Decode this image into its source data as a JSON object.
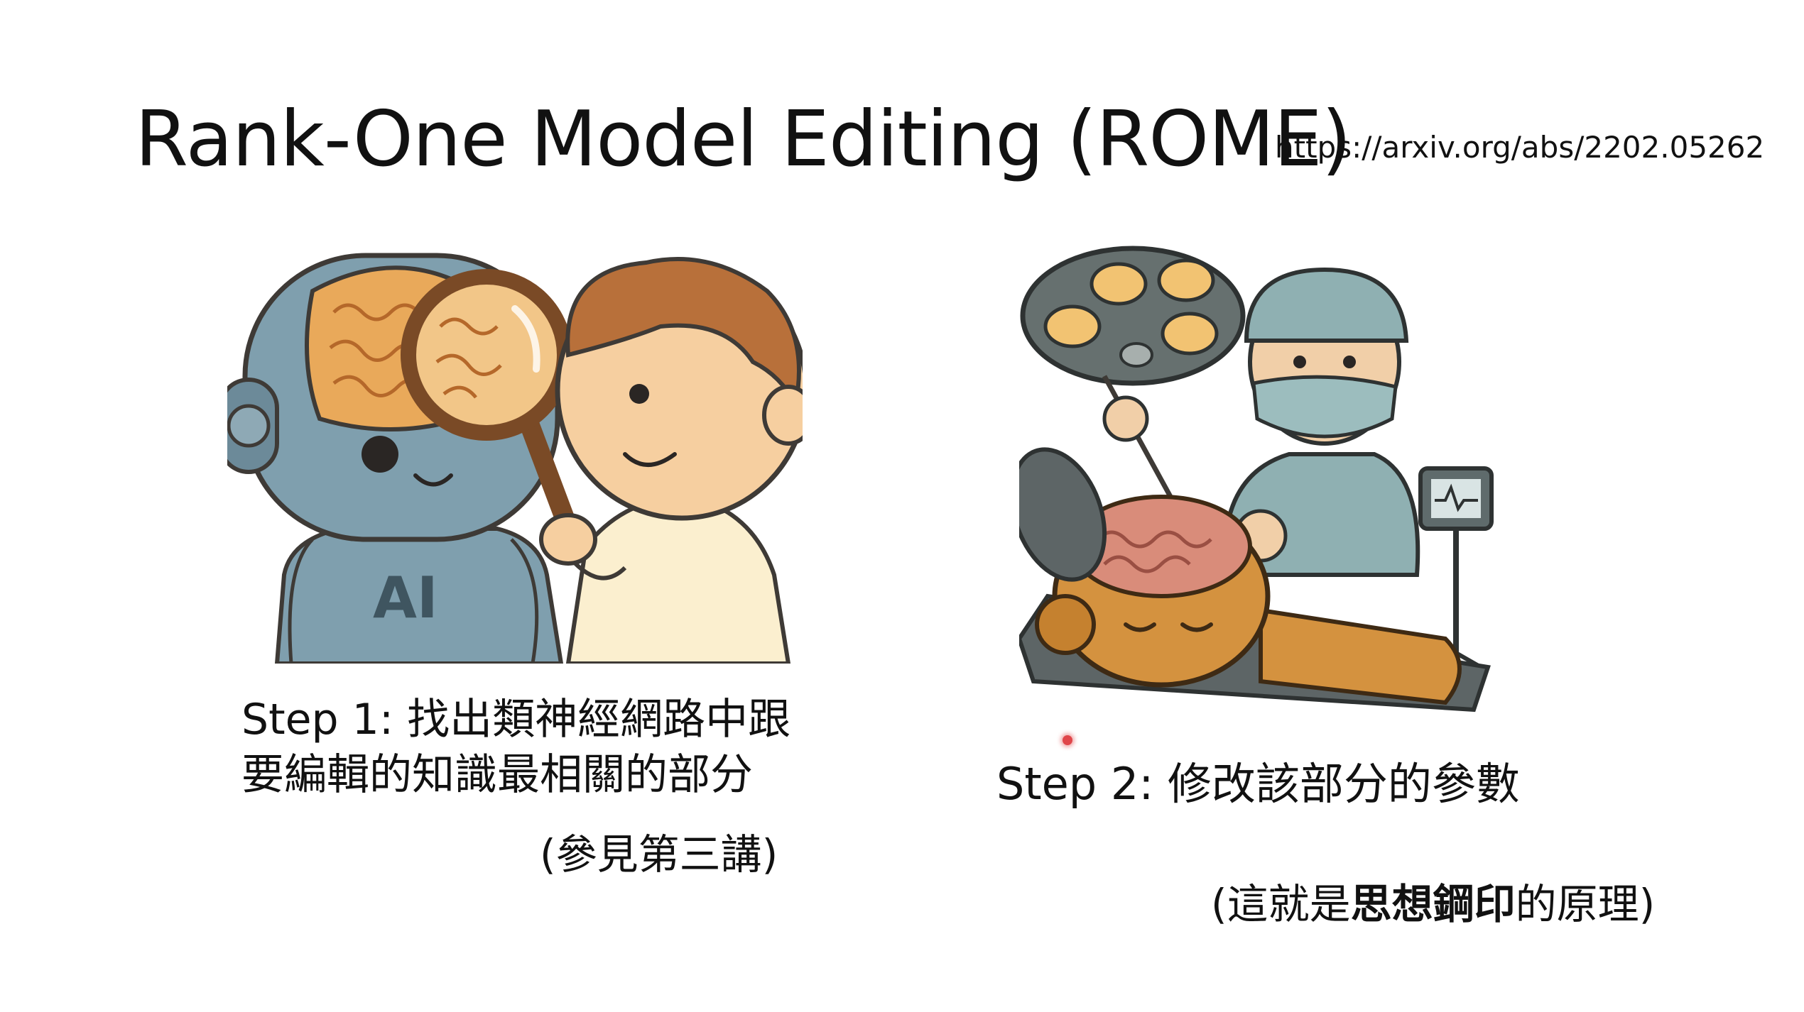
{
  "slide": {
    "title": "Rank-One Model Editing (ROME)",
    "url": "https://arxiv.org/abs/2202.05262",
    "step1": {
      "line1": "Step 1: 找出類神經網路中跟",
      "line2": "要編輯的知識最相關的部分",
      "ref": "(參見第三講)"
    },
    "step2": {
      "text": "Step 2: 修改該部分的參數"
    },
    "principle": {
      "prefix": "(這就是",
      "bold": "思想鋼印",
      "suffix": "的原理)"
    },
    "illustration1": {
      "robot_label": "AI"
    }
  },
  "colors": {
    "robot_blue": "#7f9fae",
    "brain_orange": "#e9a95a",
    "skin": "#f6cfa0",
    "hair_brown": "#b8703a",
    "surgeon_scrubs": "#8fb0b2",
    "gold_robot": "#d4923f",
    "brain_pink": "#d98c7a",
    "lamp_gray": "#66706f",
    "laser_red": "#e0464a"
  }
}
